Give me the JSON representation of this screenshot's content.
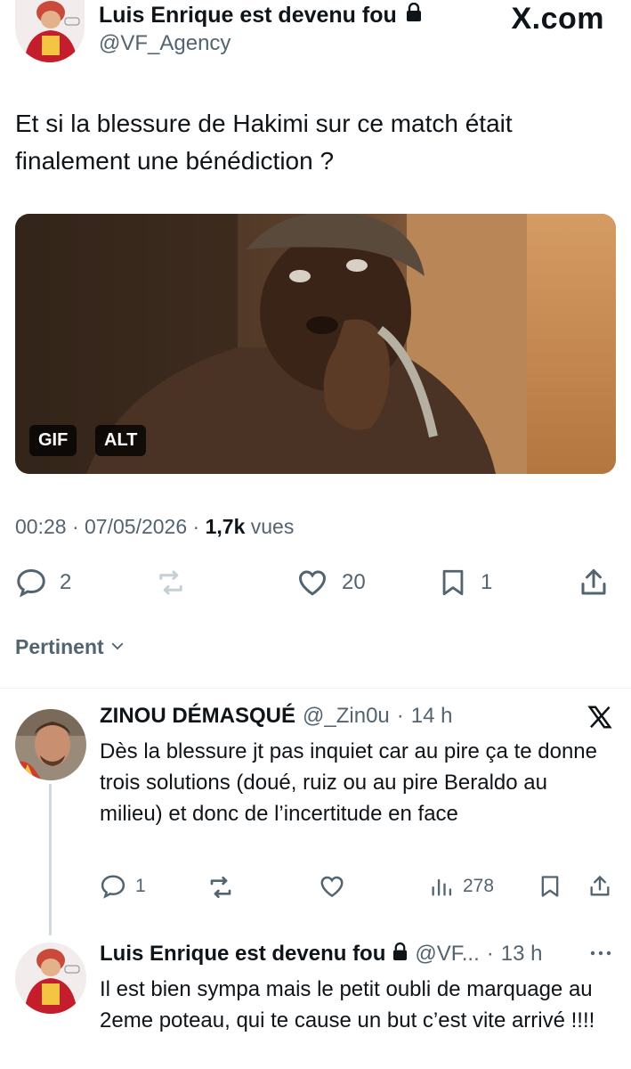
{
  "header": {
    "author_name": "Luis Enrique est devenu fou",
    "author_handle": "@VF_Agency",
    "site": "X.com"
  },
  "tweet": {
    "text": "Et si la blessure de Hakimi sur ce match était finalement une bénédiction ?",
    "media": {
      "badge_gif": "GIF",
      "badge_alt": "ALT"
    },
    "meta": {
      "time": "00:28",
      "date": "07/05/2026",
      "views_count": "1,7k",
      "views_label": "vues"
    },
    "actions": {
      "replies": "2",
      "likes": "20",
      "bookmarks": "1"
    }
  },
  "sort": {
    "label": "Pertinent"
  },
  "replies": [
    {
      "name": "ZINOU DÉMASQUÉ",
      "handle": "@_Zin0u",
      "time": "14 h",
      "text": "Dès la blessure jt pas inquiet car au pire ça te donne trois solutions (doué, ruiz ou au pire Beraldo au milieu) et donc de l’incertitude en face",
      "actions": {
        "replies": "1",
        "views": "278"
      }
    },
    {
      "name": "Luis Enrique est devenu fou",
      "handle": "@VF...",
      "time": "13 h",
      "text": "Il est bien sympa mais le petit oubli de marquage au 2eme poteau, qui te cause un but c’est vite arrivé !!!!"
    }
  ],
  "icons": {
    "lock": "lock-icon",
    "x_logo": "x-logo-icon",
    "reply": "reply-icon",
    "repost": "repost-icon",
    "like": "heart-icon",
    "bookmark": "bookmark-icon",
    "share": "share-icon",
    "views": "views-icon",
    "more": "more-icon",
    "chevron": "chevron-down-icon"
  },
  "colors": {
    "text": "#0f1419",
    "secondary": "#536471",
    "divider": "#eff3f4",
    "disabled": "#c4cfd6"
  }
}
